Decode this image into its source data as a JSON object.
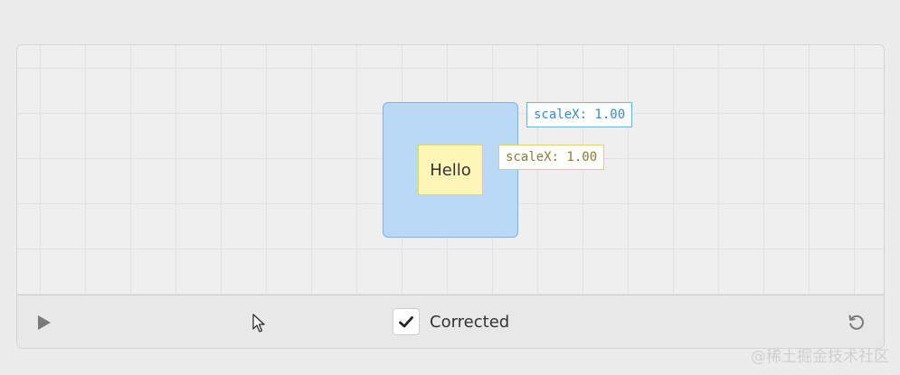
{
  "stage": {
    "parent_label": "scaleX: 1.00",
    "child_label": "scaleX: 1.00",
    "child_text": "Hello"
  },
  "controls": {
    "corrected_label": "Corrected",
    "corrected_checked": true
  },
  "icons": {
    "play": "play-icon",
    "checkmark": "checkmark-icon",
    "reset": "reset-icon",
    "cursor": "mouse-cursor-icon"
  },
  "colors": {
    "parent_fill": "#b9d9f6",
    "parent_border": "#7fb3e3",
    "child_fill": "#fef5b7",
    "child_border": "#e9d56b",
    "label_blue": "#3b86c8",
    "label_yellow": "#8a7a3a"
  },
  "watermark": "@稀土掘金技术社区"
}
